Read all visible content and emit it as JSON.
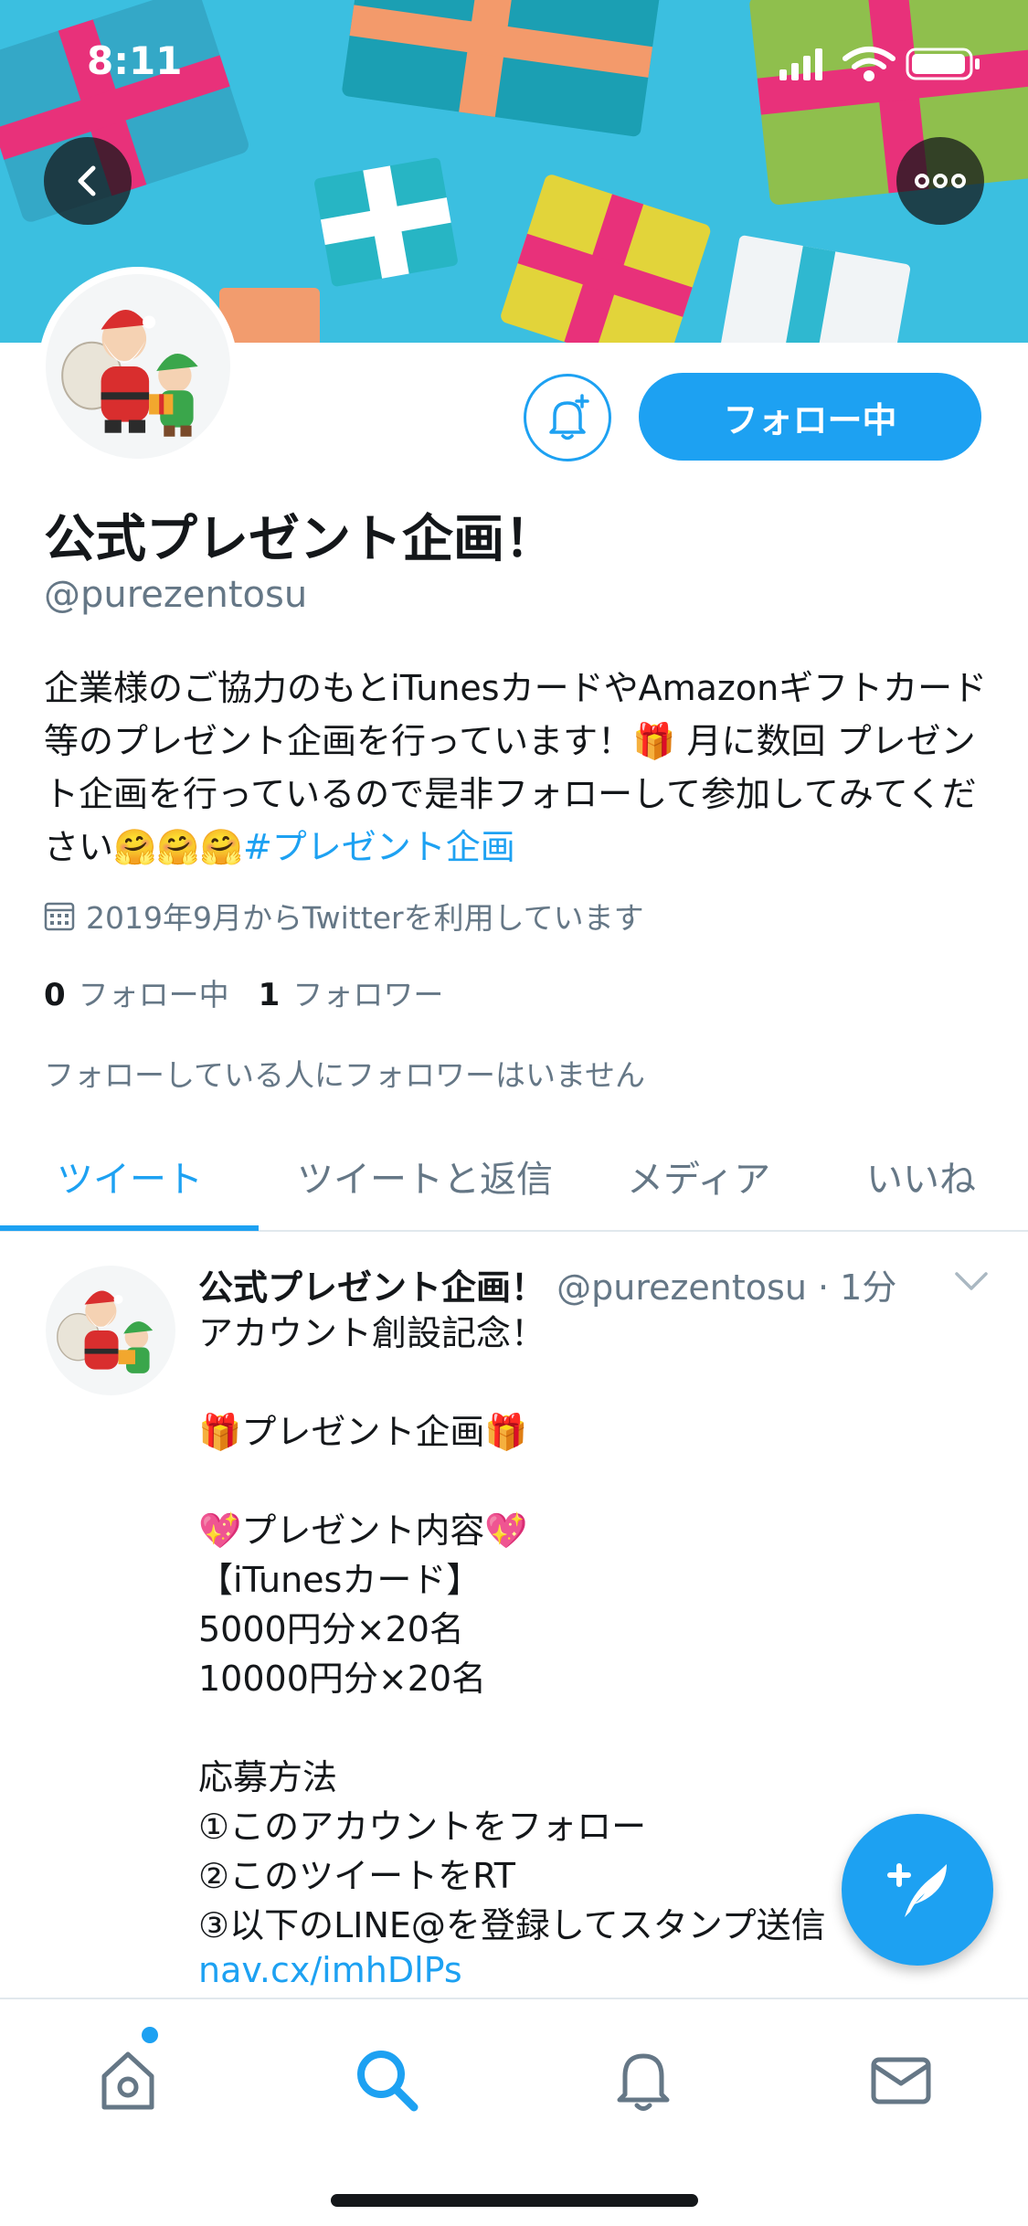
{
  "status_bar": {
    "time": "8:11"
  },
  "profile": {
    "display_name": "公式プレゼント企画！",
    "handle": "@purezentosu",
    "follow_button": "フォロー中",
    "bio_text": "企業様のご協力のもとiTunesカードやAmazonギフトカード等のプレゼント企画を行っています！🎁 月に数回 プレゼント企画を行っているので是非フォローして参加してみてください🤗🤗🤗",
    "bio_hashtag": "#プレゼント企画",
    "joined": "2019年9月からTwitterを利用しています",
    "following_count": "0",
    "following_label": "フォロー中",
    "followers_count": "1",
    "followers_label": "フォロワー",
    "mutual_note": "フォローしている人にフォロワーはいません"
  },
  "tabs": [
    {
      "label": "ツイート",
      "active": true
    },
    {
      "label": "ツイートと返信",
      "active": false
    },
    {
      "label": "メディア",
      "active": false
    },
    {
      "label": "いいね",
      "active": false
    }
  ],
  "tweet": {
    "name": "公式プレゼント企画！",
    "meta": "@purezentosu · 1分",
    "body": "アカウント創設記念！\n\n🎁プレゼント企画🎁\n\n💖プレゼント内容💖\n【iTunesカード】\n5000円分×20名\n10000円分×20名\n\n応募方法\n①このアカウントをフォロー\n②このツイートをRT\n③以下のLINE@を登録してスタンプ送信",
    "link": "nav.cx/imhDlPs"
  },
  "icons": {
    "back": "back-arrow-icon",
    "more": "more-dots-icon",
    "bell": "notification-bell-plus-icon",
    "calendar": "calendar-icon",
    "fab": "compose-tweet-icon",
    "nav": [
      "home-icon",
      "search-icon",
      "notifications-icon",
      "messages-icon"
    ]
  },
  "colors": {
    "accent": "#1da1f2",
    "text": "#14171a",
    "secondary": "#657786",
    "banner": "#3bbfe0"
  }
}
